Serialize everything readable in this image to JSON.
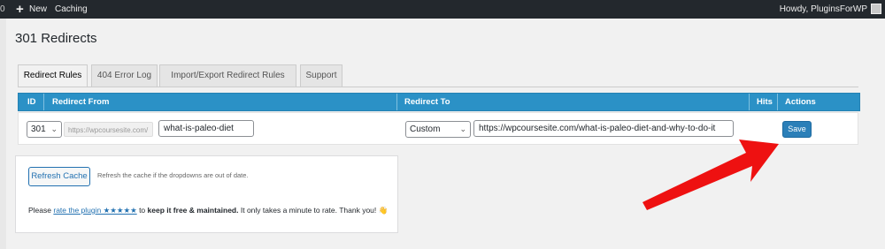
{
  "adminbar": {
    "count": "0",
    "plus_icon": "+",
    "new_label": "New",
    "caching_label": "Caching",
    "howdy": "Howdy, PluginsForWP"
  },
  "page": {
    "title": "301 Redirects"
  },
  "tabs": [
    {
      "label": "Redirect Rules",
      "active": true
    },
    {
      "label": "404 Error Log",
      "active": false
    },
    {
      "label": "Import/Export Redirect Rules",
      "active": false
    },
    {
      "label": "Support",
      "active": false
    }
  ],
  "table": {
    "headers": [
      "ID",
      "Redirect From",
      "Redirect To",
      "Hits",
      "Actions"
    ],
    "row": {
      "code": "301",
      "prefix": "https://wpcoursesite.com/",
      "from": "what-is-paleo-diet",
      "to_type": "Custom",
      "to_url": "https://wpcoursesite.com/what-is-paleo-diet-and-why-to-do-it",
      "save_label": "Save"
    }
  },
  "panel": {
    "refresh_label": "Refresh Cache",
    "refresh_hint": "Refresh the cache if the dropdowns are out of date.",
    "rate_pre": "Please ",
    "rate_link": "rate the plugin ★★★★★",
    "rate_mid": " to ",
    "rate_bold": "keep it free & maintained.",
    "rate_post": " It only takes a minute to rate. Thank you! ",
    "rate_emoji": "👋"
  },
  "colors": {
    "header_blue": "#2b91c6",
    "save_blue": "#2b7fb8",
    "arrow_red": "#ee1111",
    "adminbar": "#23282d"
  }
}
